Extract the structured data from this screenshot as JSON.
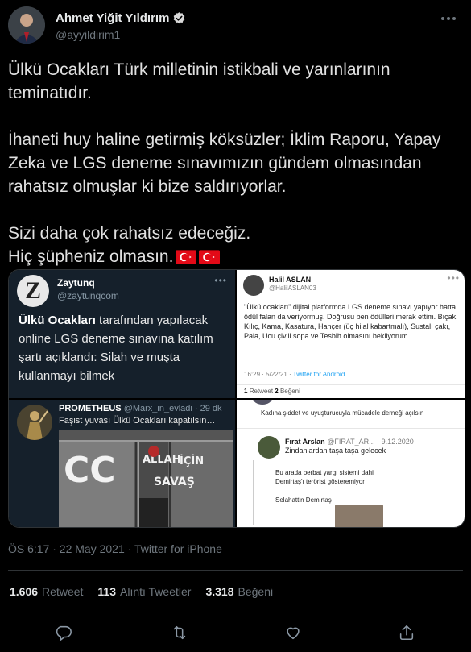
{
  "author": {
    "name": "Ahmet Yiğit Yıldırım",
    "handle": "@ayyildirim1"
  },
  "tweet": {
    "paragraphs": [
      "Ülkü Ocakları Türk milletinin istikbali ve yarınlarının teminatıdır.",
      "İhaneti huy haline getirmiş köksüzler; İklim Raporu, Yapay Zeka ve LGS deneme sınavımızın gündem olmasından rahatsız olmuşlar ki bize saldırıyorlar.",
      "Sizi daha çok rahatsız edeceğiz.",
      "Hiç şüpheniz olmasın."
    ],
    "flag_icons": [
      "turkey-flag-icon",
      "turkey-flag-icon"
    ]
  },
  "media": {
    "m1": {
      "name": "Zaytunq",
      "handle": "@zaytunqcom",
      "logo_letter": "Z",
      "more": "•••",
      "bold": "Ülkü Ocakları",
      "body": " tarafından yapılacak online LGS deneme sınavına katılım şartı açıklandı: Silah ve muşta kullanmayı bilmek"
    },
    "m2": {
      "name": "Halil ASLAN",
      "handle": "@HalilASLAN03",
      "more": "•••",
      "body": "\"Ülkü ocakları\" dijital platformda LGS deneme sınavı yapıyor hatta ödül falan da veriyormuş. Doğrusu ben ödülleri merak ettim. Bıçak, Kılıç, Kama, Kasatura, Hançer (üç hilal kabartmalı), Sustalı çakı, Pala, Ucu çivili sopa ve Tesbih olmasını bekliyorum.",
      "time": "16:29 · 5/22/21 · ",
      "client": "Twitter for Android",
      "retweets_num": "1",
      "retweets_label": "Retweet",
      "likes_num": "2",
      "likes_label": "Beğeni"
    },
    "m3": {
      "name": "PROMETHEUS",
      "handle": "@Marx_in_evladi · 29 dk",
      "text": "Faşist yuvası Ülkü Ocakları kapatılsın…",
      "graffiti": [
        "CC",
        "ALLAH",
        "İÇİN",
        "SAVAŞ"
      ]
    },
    "m4": {
      "top_text": "Kadına şiddet ve uyuşturucuyla mücadele derneği açılsın",
      "name": "Fırat Arslan",
      "handle": "@FIRAT_AR... · 9.12.2020",
      "line1": "Zindanlardan taşa taşa gelecek",
      "line2a": "Bu arada berbat yargı sistemi dahi",
      "line2b": "Demirtaş'ı terörist gösteremiyor",
      "line3": "Selahattin Demirtaş"
    }
  },
  "timestamp": "ÖS 6:17 · 22 May 2021 · Twitter for iPhone",
  "stats": {
    "retweets": {
      "value": "1.606",
      "label": "Retweet"
    },
    "quotes": {
      "value": "113",
      "label": "Alıntı Tweetler"
    },
    "likes": {
      "value": "3.318",
      "label": "Beğeni"
    }
  },
  "actions": [
    "reply-icon",
    "retweet-icon",
    "like-icon",
    "share-icon"
  ],
  "colors": {
    "background": "#000000",
    "muted": "#6e767d",
    "text": "#e7e9ea",
    "verified": "#d9d9d9",
    "flag_red": "#e30a17"
  }
}
